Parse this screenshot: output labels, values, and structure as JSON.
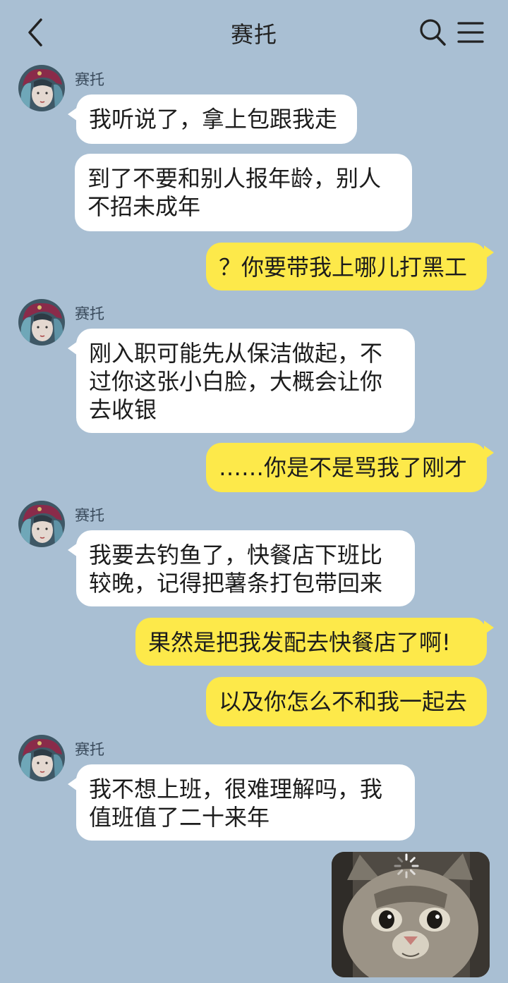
{
  "header": {
    "title": "赛托",
    "back_icon": "chevron-left-icon",
    "search_icon": "search-icon",
    "menu_icon": "hamburger-menu-icon"
  },
  "messages": [
    {
      "side": "left",
      "sender": "赛托",
      "text": "我听说了，拿上包跟我走"
    },
    {
      "side": "left",
      "text": "到了不要和别人报年龄，别人\n不招未成年"
    },
    {
      "side": "right",
      "text": "？你要带我上哪儿打黑工"
    },
    {
      "side": "left",
      "sender": "赛托",
      "text": "刚入职可能先从保洁做起，不\n过你这张小白脸，大概会让你\n去收银"
    },
    {
      "side": "right",
      "text": "……你是不是骂我了刚才"
    },
    {
      "side": "left",
      "sender": "赛托",
      "text": "我要去钓鱼了，快餐店下班比\n较晚，记得把薯条打包带回来"
    },
    {
      "side": "right",
      "text": "果然是把我发配去快餐店了啊!"
    },
    {
      "side": "right",
      "text": "以及你怎么不和我一起去"
    },
    {
      "side": "left",
      "sender": "赛托",
      "text": "我不想上班，很难理解吗，我\n值班值了二十来年"
    }
  ],
  "colors": {
    "background": "#a9bfd3",
    "left_bubble": "#ffffff",
    "right_bubble": "#fde94a"
  }
}
